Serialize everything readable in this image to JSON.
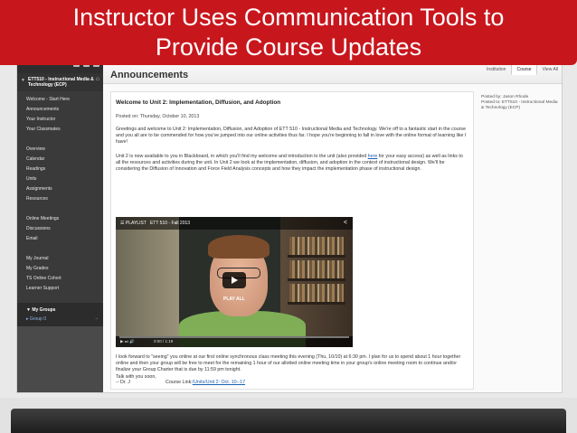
{
  "banner": {
    "line1": "Instructor Uses Communication Tools to",
    "line2": "Provide Course Updates"
  },
  "sidebar": {
    "course_title": "ETT510 - Instructional Media & Technology (ECP)",
    "group1": [
      "Welcome - Start Here",
      "Announcements",
      "Your Instructor",
      "Your Classmates"
    ],
    "group2": [
      "Overview",
      "Calendar",
      "Readings",
      "Units",
      "Assignments",
      "Resources"
    ],
    "group3": [
      "Online Meetings",
      "Discussions",
      "Email"
    ],
    "group4": [
      "My Journal",
      "My Grades",
      "TS Online Cohort",
      "Learner Support"
    ],
    "groups_header": "My Groups",
    "group_item": "Group 0"
  },
  "content": {
    "heading": "Announcements",
    "tabs": [
      "Institution",
      "Course",
      "View All"
    ],
    "post_title": "Welcome to Unit 2: Implementation, Diffusion, and Adoption",
    "posted_on": "Posted on: Thursday, October 10, 2013",
    "para1": "Greetings and welcome to Unit 2: Implementation, Diffusion, and Adoption of ETT 510 - Instructional Media and Technology.  We're off to a fantastic start in the course and you all are to be commended for how you've jumped into our online activities thus far.  I hope you're beginning to fall in love with the online format of learning like I have!",
    "para2_a": "Unit 2 is now available to you in Blackboard, in which you'll find my welcome and introduction to the unit (also provided ",
    "para2_link": "here",
    "para2_b": " for your easy access) as well as links to all the resources and activities during the unit.  In Unit 2 we look at the implementation, diffusion, and adoption in the context of instructional design.  We'll be considering the Diffusion of Innovation and Force Field Analysis concepts and how they impact the implementation phase of instructional design.",
    "para3": "I look forward to \"seeing\" you online at our first online synchronous class meeting this evening (Thu, 10/10) at 6:30 pm.  I plan for us to spend about 1 hour together online and then your group will be free to meet for the remaining 1 hour of our allotted online meeting time in your group's online meeting room to continue and/or finalize your Group Charter that is due by 11:59 pm tonight.",
    "para4": "Talk with you soon,",
    "signature": "-- Dr. J",
    "course_link_label": "Course Link:",
    "course_link": "/Units/Unit 2: Oct. 10--17",
    "posted_by": "Posted by: Jason Rhode",
    "posted_to": "Posted to: ETT510 - Instructional Media & Technology (ECP)"
  },
  "video": {
    "playlist_label": "PLAYLIST",
    "title": "ETT 510 - Fall 2013",
    "play_all": "PLAY ALL",
    "time": "0:00 / 1:19"
  },
  "colors": {
    "banner": "#c8161d",
    "sidebar": "#3a3a3a",
    "link": "#1b5fb0"
  }
}
